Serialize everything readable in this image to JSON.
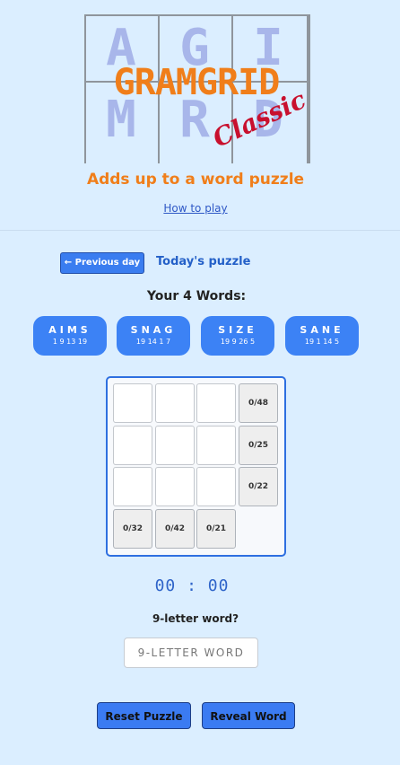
{
  "logo": {
    "letters": [
      "A",
      "G",
      "I",
      "M",
      "R",
      "D"
    ],
    "title": "GRAMGRID",
    "subtitle": "Classic"
  },
  "tagline": "Adds up to a word puzzle",
  "how_to_play": "How to play",
  "nav": {
    "previous_day": "← Previous day",
    "today": "Today's puzzle"
  },
  "words_heading": "Your 4 Words:",
  "words": [
    {
      "word": "AIMS",
      "numbers": "1 9 13 19"
    },
    {
      "word": "SNAG",
      "numbers": "19 14 1 7"
    },
    {
      "word": "SIZE",
      "numbers": "19 9 26 5"
    },
    {
      "word": "SANE",
      "numbers": "19 1 14 5"
    }
  ],
  "grid": {
    "row_sums": [
      "0/48",
      "0/25",
      "0/22"
    ],
    "col_sums": [
      "0/32",
      "0/42",
      "0/21"
    ]
  },
  "timer": "00 : 00",
  "nine_letter_question": "9-letter word?",
  "nine_letter_placeholder": "9-LETTER WORD",
  "buttons": {
    "reset": "Reset Puzzle",
    "reveal": "Reveal Word"
  },
  "colors": {
    "accent": "#3b7bf2",
    "orange": "#f07e1a",
    "background": "#dbeeff"
  }
}
